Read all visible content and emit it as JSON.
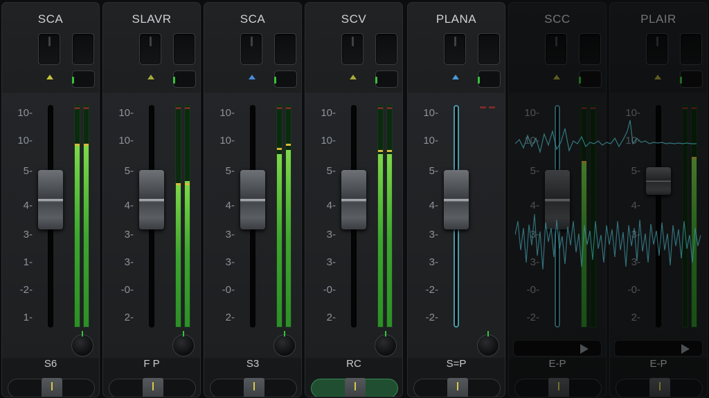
{
  "strips": [
    {
      "name": "SCA",
      "io": "S6",
      "scale": [
        "10-",
        "10-",
        "5-",
        "4-",
        "3-",
        "1-",
        "-2-",
        "1-"
      ],
      "meter": [
        0.82,
        0.82
      ],
      "peak": [
        0.82,
        0.82
      ],
      "arrow_color": "#c8c23a",
      "pan_active": false,
      "dim": false,
      "knob": true
    },
    {
      "name": "SLAVR",
      "io": "F P",
      "scale": [
        "10-",
        "10-",
        "5-",
        "4-",
        "3-",
        "3-",
        "-0-",
        "2-"
      ],
      "meter": [
        0.65,
        0.66
      ],
      "peak": [
        0.64,
        0.64
      ],
      "arrow_color": "#a8a83a",
      "pan_active": false,
      "dim": false,
      "knob": true
    },
    {
      "name": "SCA",
      "io": "S3",
      "scale": [
        "10-",
        "10-",
        "5-",
        "4-",
        "3-",
        "3-",
        "-0-",
        "2-"
      ],
      "meter": [
        0.78,
        0.8
      ],
      "peak": [
        0.8,
        0.82
      ],
      "arrow_color": "#4a8ad8",
      "pan_active": false,
      "dim": false,
      "knob": true
    },
    {
      "name": "SCV",
      "io": "RC",
      "scale": [
        "10-",
        "10-",
        "5-",
        "4-",
        "3-",
        "3-",
        "-0-",
        "2-"
      ],
      "meter": [
        0.78,
        0.78
      ],
      "peak": [
        0.79,
        0.79
      ],
      "arrow_color": "#a8a83a",
      "pan_active": true,
      "dim": false,
      "knob": true
    },
    {
      "name": "PLANA",
      "io": "S=P",
      "scale": [
        "10-",
        "10-",
        "5-",
        "4-",
        "3-",
        "3-",
        "-2-",
        "-2-"
      ],
      "meter": [
        0.0,
        0.0
      ],
      "peak": [
        0.0,
        0.0
      ],
      "arrow_color": "#4a9ad8",
      "pan_active": false,
      "dim": false,
      "knob": true
    },
    {
      "name": "SCC",
      "io": "E-P",
      "scale": [
        "10-",
        "10-",
        "5-",
        "4-",
        "3-",
        "3-",
        "-0-",
        "-2-"
      ],
      "meter": [
        0.74,
        0.0
      ],
      "peak": [
        0.74,
        0.0
      ],
      "arrow_color": "#a8a83a",
      "pan_active": false,
      "dim": true,
      "knob": false
    },
    {
      "name": "PLAIR",
      "io": "E-P",
      "scale": [
        "10-",
        "10-",
        "5-",
        "4-",
        "3-",
        "3-",
        "-0-",
        "2-"
      ],
      "meter": [
        0.0,
        0.76
      ],
      "peak": [
        0.0,
        0.76
      ],
      "arrow_color": "#a8a83a",
      "pan_active": false,
      "dim": true,
      "knob": false
    }
  ]
}
